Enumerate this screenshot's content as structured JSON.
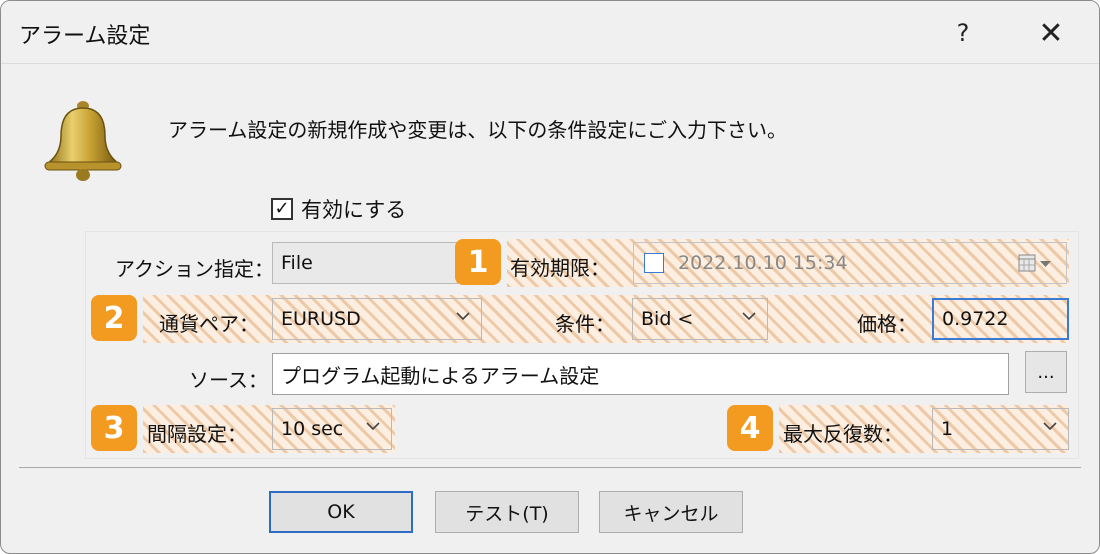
{
  "window": {
    "title": "アラーム設定",
    "help_label": "?",
    "close_label": "✕"
  },
  "intro_text": "アラーム設定の新規作成や変更は、以下の条件設定にご入力下さい。",
  "enable": {
    "label": "有効にする",
    "checked": true,
    "check_glyph": "✓"
  },
  "form": {
    "action": {
      "label": "アクション指定：",
      "value": "File"
    },
    "expiry": {
      "label": "有効期限：",
      "value": "2022.10.10 15:34",
      "checked": false
    },
    "pair": {
      "label": "通貨ペア：",
      "value": "EURUSD"
    },
    "condition": {
      "label": "条件：",
      "value": "Bid <"
    },
    "price": {
      "label": "価格：",
      "value": "0.9722"
    },
    "source": {
      "label": "ソース：",
      "value": "プログラム起動によるアラーム設定",
      "browse_label": "..."
    },
    "interval": {
      "label": "間隔設定：",
      "value": "10 sec"
    },
    "max_repeat": {
      "label": "最大反復数：",
      "value": "1"
    }
  },
  "badges": [
    "1",
    "2",
    "3",
    "4"
  ],
  "buttons": {
    "ok": "OK",
    "test": "テスト(T)",
    "cancel": "キャンセル"
  },
  "colors": {
    "badge": "#f39a20",
    "hatch": "#fcefe2",
    "focus_border": "#3a7bd5",
    "default_button_border": "#2b6cc4"
  },
  "icons": {
    "bell": "bell-icon",
    "dropdown": "chevron-down-icon",
    "calendar": "calendar-icon"
  }
}
